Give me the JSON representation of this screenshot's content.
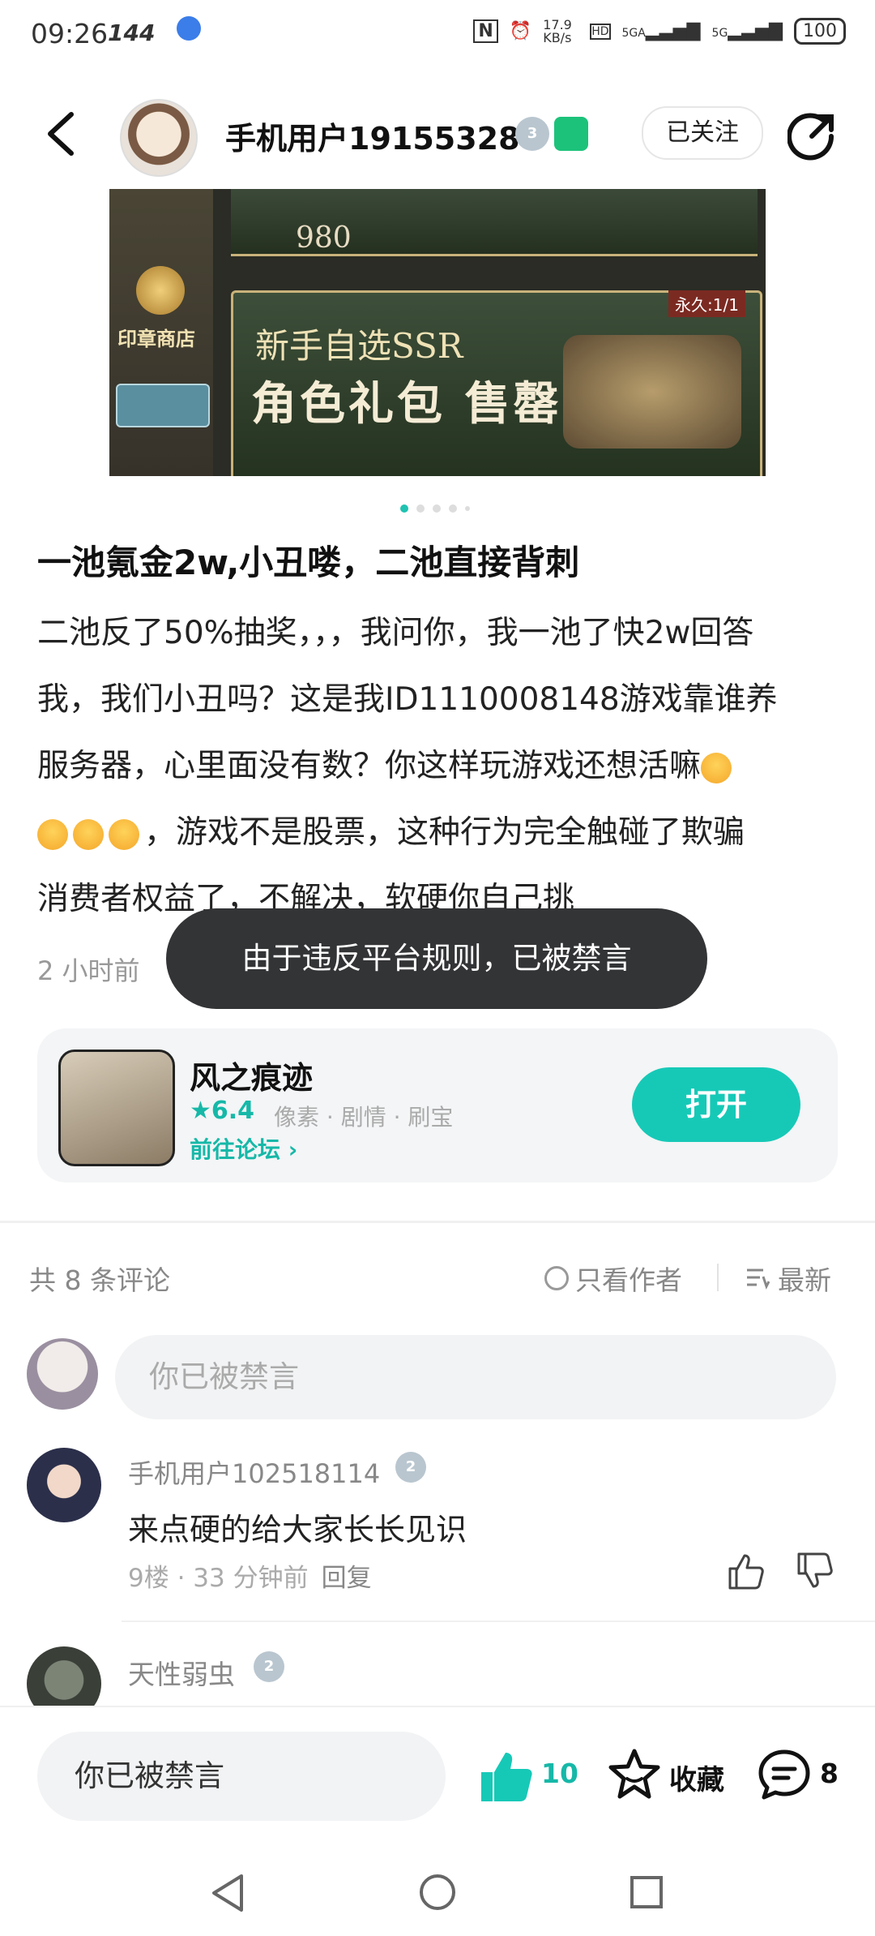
{
  "status_bar": {
    "time": "09:26",
    "refresh_rate": "144",
    "network_speed": "17.9 KB/s",
    "signal_1": "5GA",
    "signal_2": "5G",
    "battery": "100"
  },
  "header": {
    "username": "手机用户19155328",
    "level_badge": "3",
    "follow_label": "已关注"
  },
  "banner": {
    "price": "980",
    "shop_label": "印章商店",
    "line1": "新手自选SSR",
    "line2": "角色礼包 售罄",
    "tag": "永久:1/1",
    "page_count": 5,
    "active_page": 0
  },
  "post": {
    "title": "一池氪金2w,小丑喽，二池直接背刺",
    "body_lines": [
      "二池反了50%抽奖，，，我问你，我一池了快2w回答",
      "我，我们小丑吗？这是我ID1110008148游戏靠谁养",
      "服务器，心里面没有数？你这样玩游戏还想活嘛",
      "，游戏不是股票，这种行为完全触碰了欺骗",
      "消费者权益了，不解决，软硬你自己挑"
    ],
    "time": "2 小时前"
  },
  "toast": "由于违反平台规则，已被禁言",
  "game": {
    "name": "风之痕迹",
    "score": "★6.4",
    "tags": "像素 · 剧情 · 刷宝",
    "forum_link": "前往论坛 ›",
    "open_label": "打开"
  },
  "comments_header": {
    "count": "共 8 条评论",
    "author_only": "只看作者",
    "sort": "最新"
  },
  "comment_input": {
    "placeholder": "你已被禁言"
  },
  "comments": [
    {
      "user": "手机用户102518114",
      "level": "2",
      "text": "来点硬的给大家长长见识",
      "meta": "9楼 · 33 分钟前",
      "reply": "回复"
    },
    {
      "user": "天性弱虫",
      "level": "2"
    }
  ],
  "bottom_bar": {
    "input": "你已被禁言",
    "likes": "10",
    "collect": "收藏",
    "comments": "8"
  },
  "colors": {
    "accent": "#16c9b7",
    "toast_bg": "#333436"
  }
}
